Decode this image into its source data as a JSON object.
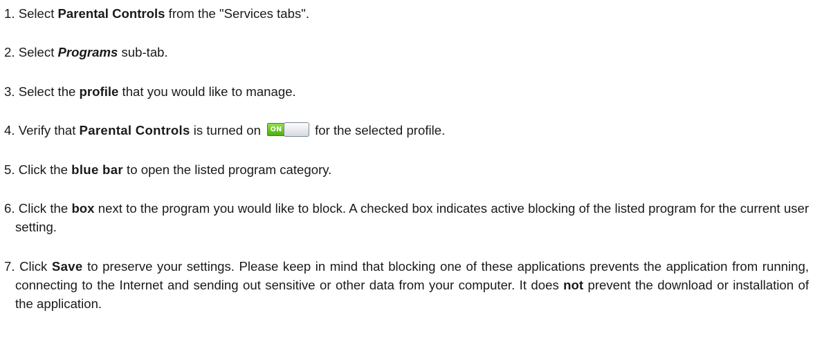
{
  "steps": [
    {
      "num": "1.",
      "t1": "Select ",
      "b1": "Parental Controls",
      "t2": " from the \"Services tabs\"."
    },
    {
      "num": "2.",
      "t1": "Select ",
      "b1": "Programs",
      "t2": " sub-tab."
    },
    {
      "num": "3.",
      "t1": "Select the ",
      "b1": "profile",
      "t2": " that you would like to manage."
    },
    {
      "num": "4.",
      "t1": "Verify that ",
      "b1": "Parental Controls",
      "t2": " is turned on",
      "toggle_label": "ON",
      "t3": "for the selected profile."
    },
    {
      "num": "5.",
      "t1": "Click the ",
      "b1": "blue bar",
      "t2": " to open the listed program category."
    },
    {
      "num": "6.",
      "t1": "Click the ",
      "b1": "box",
      "t2": " next to the program you would like to block. A checked box indicates active blocking of the listed program for the current user setting."
    },
    {
      "num": "7.",
      "t1": "Click ",
      "b1": "Save",
      "t2": " to preserve your settings. Please keep in mind that blocking one of these applications prevents the application from running, connecting to the Internet and sending out sensitive or other data from your computer. It does ",
      "b2": "not",
      "t3": " prevent the download or installation of the application."
    }
  ],
  "colors": {
    "text": "#1a1a1a",
    "toggle_on": "#5cbf14",
    "toggle_knob": "#e8ebee"
  }
}
